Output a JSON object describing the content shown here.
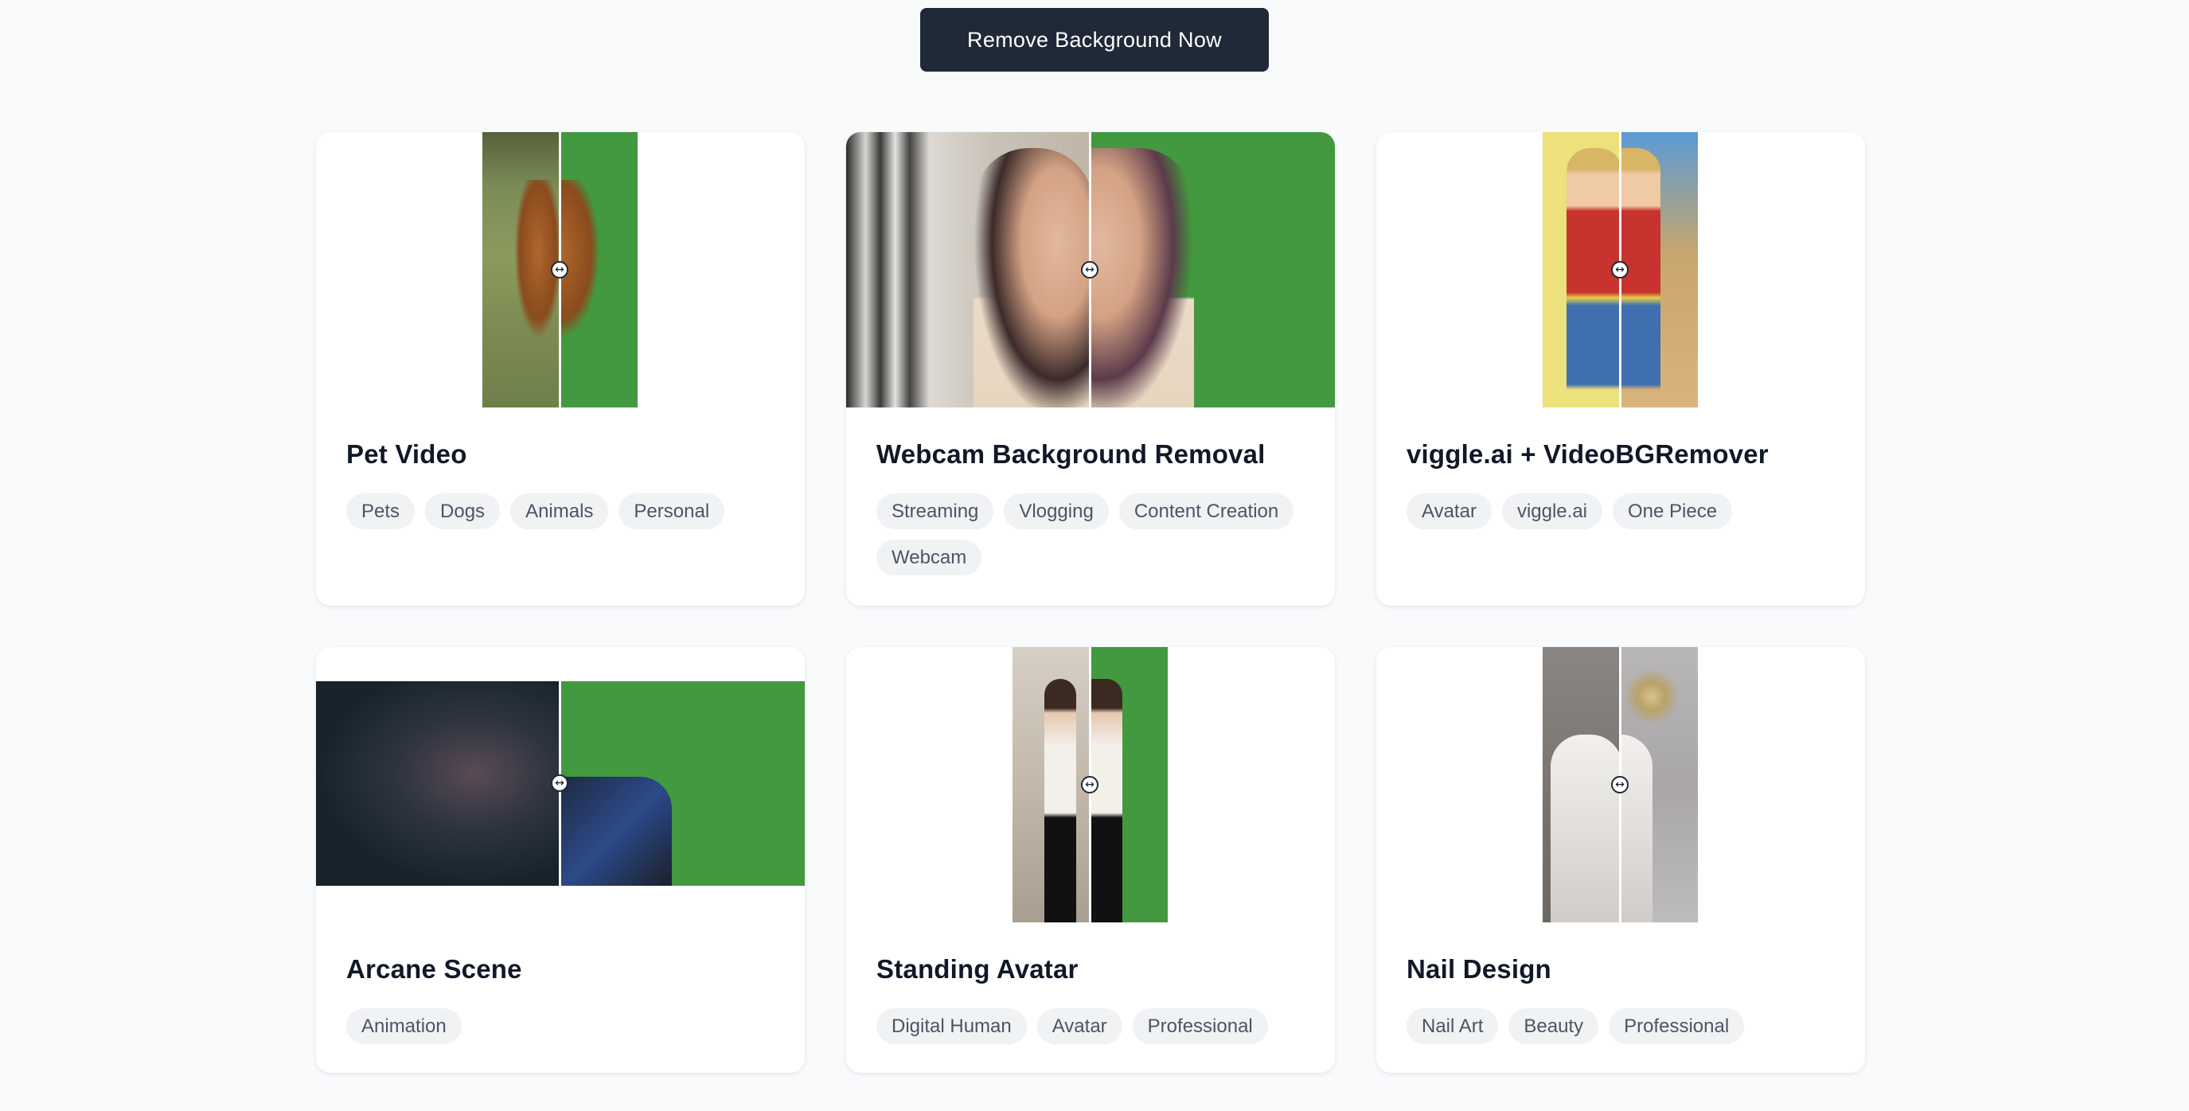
{
  "header": {
    "cta_label": "Remove Background Now"
  },
  "cards": [
    {
      "title": "Pet Video",
      "tags": [
        "Pets",
        "Dogs",
        "Animals",
        "Personal"
      ]
    },
    {
      "title": "Webcam Background Removal",
      "tags": [
        "Streaming",
        "Vlogging",
        "Content Creation",
        "Webcam"
      ]
    },
    {
      "title": "viggle.ai + VideoBGRemover",
      "tags": [
        "Avatar",
        "viggle.ai",
        "One Piece"
      ]
    },
    {
      "title": "Arcane Scene",
      "tags": [
        "Animation"
      ]
    },
    {
      "title": "Standing Avatar",
      "tags": [
        "Digital Human",
        "Avatar",
        "Professional"
      ]
    },
    {
      "title": "Nail Design",
      "tags": [
        "Nail Art",
        "Beauty",
        "Professional"
      ]
    }
  ],
  "colors": {
    "cta_bg": "#1f2937",
    "green_screen": "#43993f",
    "tag_bg": "#f1f2f4",
    "page_bg": "#f8fafc"
  },
  "icons": {
    "slider_handle": "left-right-arrow-icon"
  }
}
